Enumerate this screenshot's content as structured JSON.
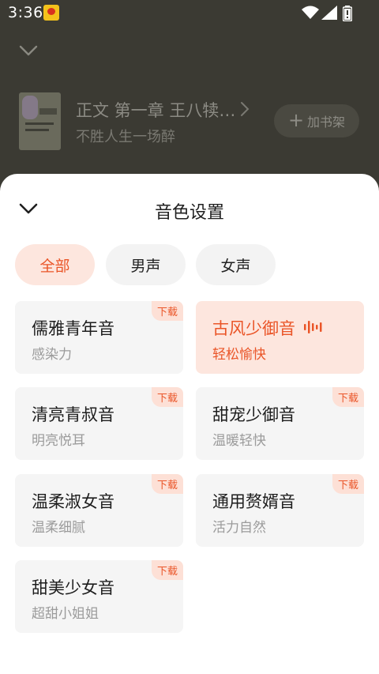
{
  "status_bar": {
    "time": "3:36"
  },
  "background_page": {
    "chapter_title": "正文 第一章 王八犊…",
    "author_line": "不胜人生一场醉",
    "add_shelf_label": "加书架"
  },
  "sheet": {
    "title": "音色设置",
    "filters": [
      {
        "label": "全部",
        "active": true
      },
      {
        "label": "男声",
        "active": false
      },
      {
        "label": "女声",
        "active": false
      }
    ],
    "download_label": "下载",
    "voices": [
      {
        "name": "儒雅青年音",
        "desc": "感染力",
        "download": true,
        "selected": false
      },
      {
        "name": "古风少御音",
        "desc": "轻松愉快",
        "download": false,
        "selected": true
      },
      {
        "name": "清亮青叔音",
        "desc": "明亮悦耳",
        "download": true,
        "selected": false
      },
      {
        "name": "甜宠少御音",
        "desc": "温暖轻快",
        "download": true,
        "selected": false
      },
      {
        "name": "温柔淑女音",
        "desc": "温柔细腻",
        "download": true,
        "selected": false
      },
      {
        "name": "通用赘婿音",
        "desc": "活力自然",
        "download": true,
        "selected": false
      },
      {
        "name": "甜美少女音",
        "desc": "超甜小姐姐",
        "download": true,
        "selected": false
      }
    ]
  },
  "colors": {
    "accent": "#ea5528",
    "accent_bg": "#fde6de",
    "card_bg": "#f5f5f5"
  }
}
